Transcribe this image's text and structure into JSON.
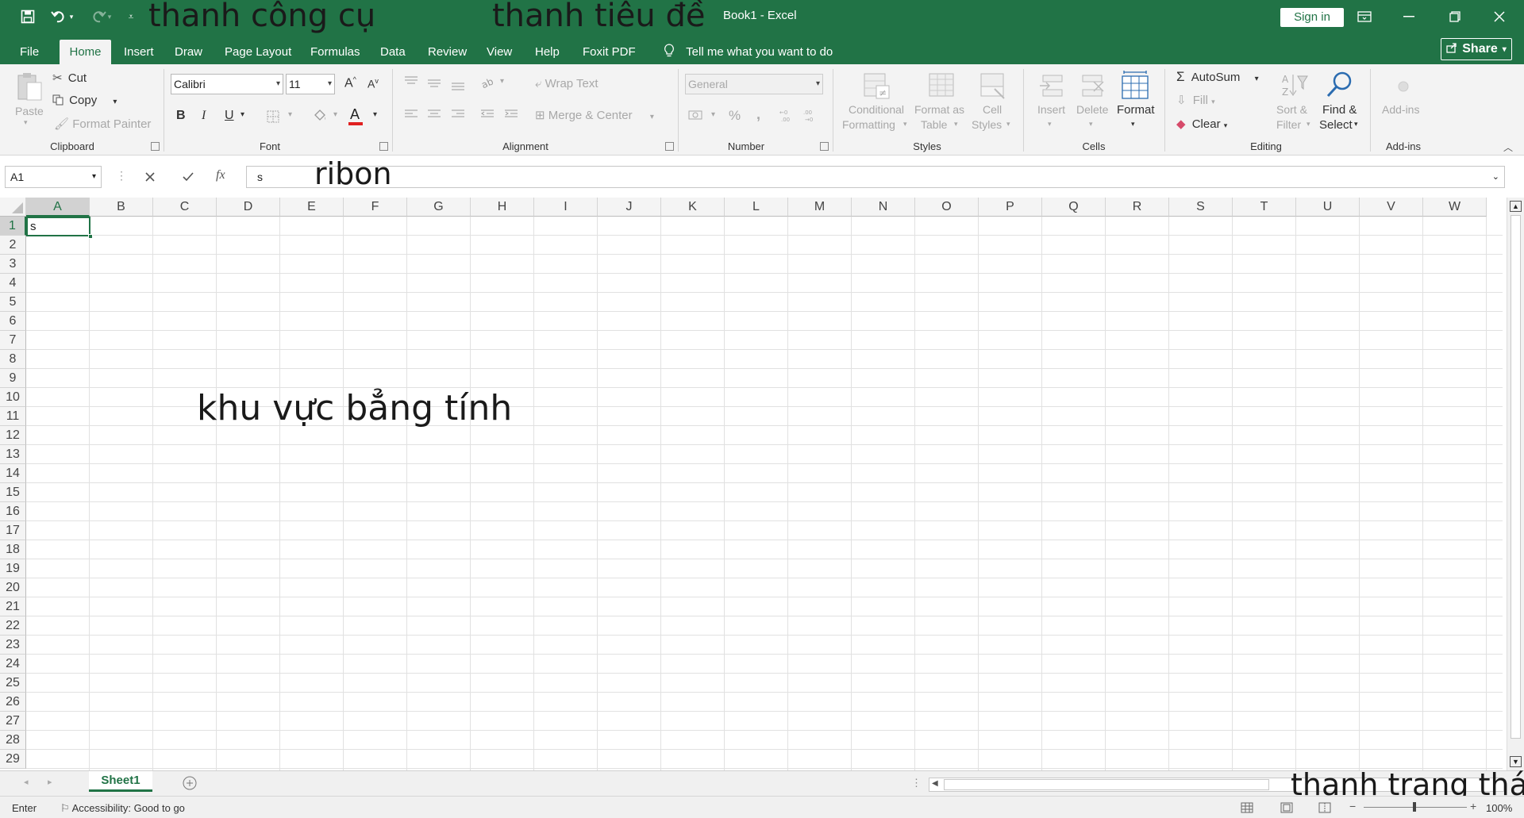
{
  "annotations": {
    "toolbar": "thanh công cụ",
    "titlebar": "thanh tiêu đề",
    "ribbon": "ribon",
    "sheet_area": "khu vực bẳng tính",
    "statusbar": "thanh trạng thái"
  },
  "title": {
    "text": "Book1  -  Excel",
    "sign_in": "Sign in"
  },
  "tabs": [
    "File",
    "Home",
    "Insert",
    "Draw",
    "Page Layout",
    "Formulas",
    "Data",
    "Review",
    "View",
    "Help",
    "Foxit PDF"
  ],
  "tell_me": "Tell me what you want to do",
  "share": "Share",
  "ribbon": {
    "clipboard": {
      "paste": "Paste",
      "cut": "Cut",
      "copy": "Copy",
      "format_painter": "Format Painter",
      "label": "Clipboard"
    },
    "font": {
      "name": "Calibri",
      "size": "11",
      "label": "Font",
      "bold": "B",
      "italic": "I",
      "underline": "U",
      "grow": "A",
      "shrink": "A",
      "color_letter": "A"
    },
    "alignment": {
      "wrap_text": "Wrap Text",
      "merge_center": "Merge & Center",
      "label": "Alignment"
    },
    "number": {
      "format": "General",
      "percent": "%",
      "comma": ",",
      "label": "Number"
    },
    "styles": {
      "conditional_1": "Conditional",
      "conditional_2": "Formatting",
      "format_table_1": "Format as",
      "format_table_2": "Table",
      "cell_styles_1": "Cell",
      "cell_styles_2": "Styles",
      "label": "Styles"
    },
    "cells": {
      "insert": "Insert",
      "delete": "Delete",
      "format": "Format",
      "label": "Cells"
    },
    "editing": {
      "autosum": "AutoSum",
      "fill": "Fill",
      "clear": "Clear",
      "sort_1": "Sort &",
      "sort_2": "Filter",
      "find_1": "Find &",
      "find_2": "Select",
      "label": "Editing"
    },
    "addins": {
      "addins": "Add-ins",
      "label": "Add-ins"
    }
  },
  "formula_bar": {
    "name_box": "A1",
    "fx": "fx",
    "value": "s"
  },
  "columns": [
    "A",
    "B",
    "C",
    "D",
    "E",
    "F",
    "G",
    "H",
    "I",
    "J",
    "K",
    "L",
    "M",
    "N",
    "O",
    "P",
    "Q",
    "R",
    "S",
    "T",
    "U",
    "V",
    "W"
  ],
  "rows": [
    "1",
    "2",
    "3",
    "4",
    "5",
    "6",
    "7",
    "8",
    "9",
    "10",
    "11",
    "12",
    "13",
    "14",
    "15",
    "16",
    "17",
    "18",
    "19",
    "20",
    "21",
    "22",
    "23",
    "24",
    "25",
    "26",
    "27",
    "28",
    "29"
  ],
  "active_cell_value": "s",
  "sheets": [
    "Sheet1"
  ],
  "status": {
    "mode": "Enter",
    "accessibility": "Accessibility: Good to go",
    "zoom": "100%"
  },
  "colors": {
    "accent": "#217346"
  }
}
